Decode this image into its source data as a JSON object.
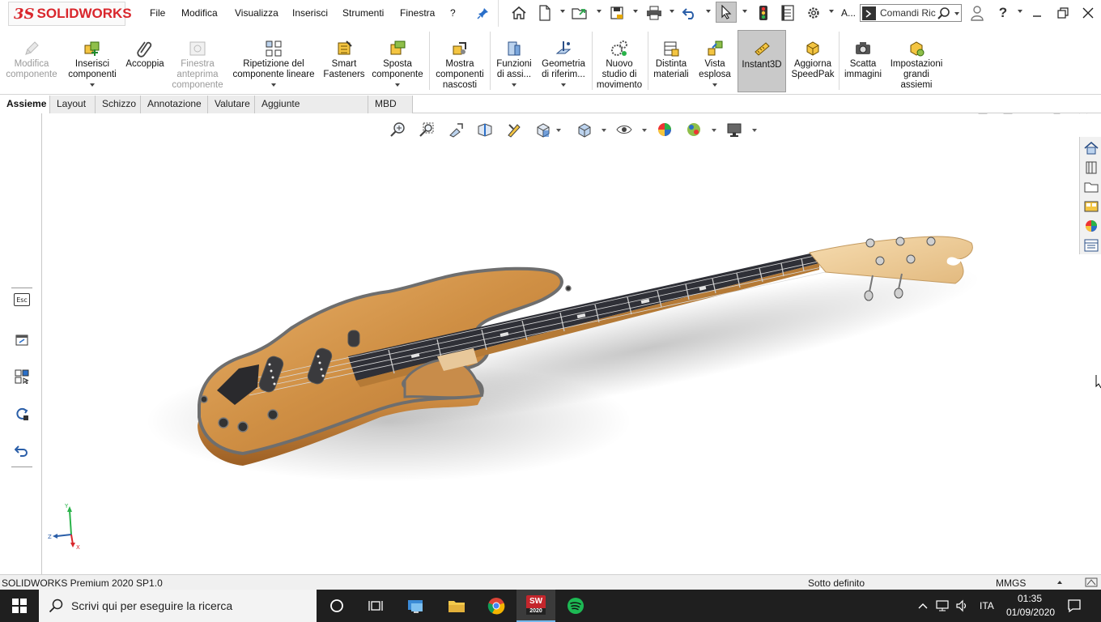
{
  "app": {
    "logo_text": "SOLIDWORKS",
    "brand_color": "#d9262c"
  },
  "menu": {
    "items": [
      "File",
      "Modifica",
      "Visualizza",
      "Inserisci",
      "Strumenti",
      "Finestra",
      "?"
    ]
  },
  "quick_access": {
    "icons": [
      "pin-icon",
      "home-icon",
      "new-document-icon",
      "open-icon",
      "save-icon",
      "print-icon",
      "undo-icon",
      "select-icon",
      "rebuild-icon",
      "file-properties-icon",
      "options-icon"
    ],
    "overflow_label": "A...",
    "search_placeholder": "Comandi Ric"
  },
  "ribbon": {
    "buttons": [
      {
        "label": "Modifica componente",
        "enabled": false,
        "icon": "edit-component-icon"
      },
      {
        "label": "Inserisci componenti",
        "enabled": true,
        "icon": "insert-components-icon",
        "dropdown": true
      },
      {
        "label": "Accoppia",
        "enabled": true,
        "icon": "mate-icon"
      },
      {
        "label": "Finestra anteprima componente",
        "enabled": false,
        "icon": "preview-window-icon"
      },
      {
        "label": "Ripetizione del componente lineare",
        "enabled": true,
        "icon": "linear-pattern-icon",
        "dropdown": true
      },
      {
        "label": "Smart Fasteners",
        "enabled": true,
        "icon": "smart-fasteners-icon"
      },
      {
        "label": "Sposta componente",
        "enabled": true,
        "icon": "move-component-icon",
        "dropdown": true
      },
      {
        "label": "Mostra componenti nascosti",
        "enabled": true,
        "icon": "show-hidden-icon"
      },
      {
        "label": "Funzioni di assi...",
        "enabled": true,
        "icon": "assembly-features-icon",
        "dropdown": true
      },
      {
        "label": "Geometria di riferim...",
        "enabled": true,
        "icon": "reference-geometry-icon",
        "dropdown": true
      },
      {
        "label": "Nuovo studio di movimento",
        "enabled": true,
        "icon": "motion-study-icon"
      },
      {
        "label": "Distinta materiali",
        "enabled": true,
        "icon": "bill-of-materials-icon"
      },
      {
        "label": "Vista esplosa",
        "enabled": true,
        "icon": "exploded-view-icon",
        "dropdown": true
      },
      {
        "label": "Instant3D",
        "enabled": true,
        "icon": "instant3d-icon",
        "pressed": true
      },
      {
        "label": "Aggiorna SpeedPak",
        "enabled": true,
        "icon": "speedpak-icon"
      },
      {
        "label": "Scatta immagini",
        "enabled": true,
        "icon": "camera-icon"
      },
      {
        "label": "Impostazioni grandi assiemi",
        "enabled": true,
        "icon": "large-assembly-icon"
      }
    ]
  },
  "tabs": [
    {
      "label": "Assieme",
      "active": true
    },
    {
      "label": "Layout",
      "active": false
    },
    {
      "label": "Schizzo",
      "active": false
    },
    {
      "label": "Annotazione",
      "active": false
    },
    {
      "label": "Valutare",
      "active": false
    },
    {
      "label": "Aggiunte SOLIDWORKS",
      "active": false
    },
    {
      "label": "MBD",
      "active": false
    }
  ],
  "left_panel": {
    "esc_label": "Esc",
    "icons": [
      "escape-icon",
      "pan-icon",
      "view-selector-icon",
      "rotate-lock-icon",
      "undo-view-icon"
    ]
  },
  "heads_up_toolbar": {
    "icons": [
      "zoom-to-fit-icon",
      "zoom-to-area-icon",
      "previous-view-icon",
      "section-view-icon",
      "dynamic-annotation-icon",
      "view-orientation-icon",
      "display-style-icon",
      "hide-show-icon",
      "edit-appearance-icon",
      "apply-scene-icon",
      "view-settings-icon"
    ]
  },
  "task_pane": {
    "icons": [
      "home-icon",
      "design-library-icon",
      "file-explorer-icon",
      "view-palette-icon",
      "appearances-icon",
      "custom-properties-icon"
    ]
  },
  "triad": {
    "y_label": "Y",
    "z_label": "Z",
    "x_label": "X"
  },
  "status_bar": {
    "product": "SOLIDWORKS Premium 2020 SP1.0",
    "state": "Sotto definito",
    "units": "MMGS"
  },
  "taskbar": {
    "search_placeholder": "Scrivi qui per eseguire la ricerca",
    "sw_badge": "2020",
    "language": "ITA",
    "time": "01:35",
    "date": "01/09/2020"
  }
}
